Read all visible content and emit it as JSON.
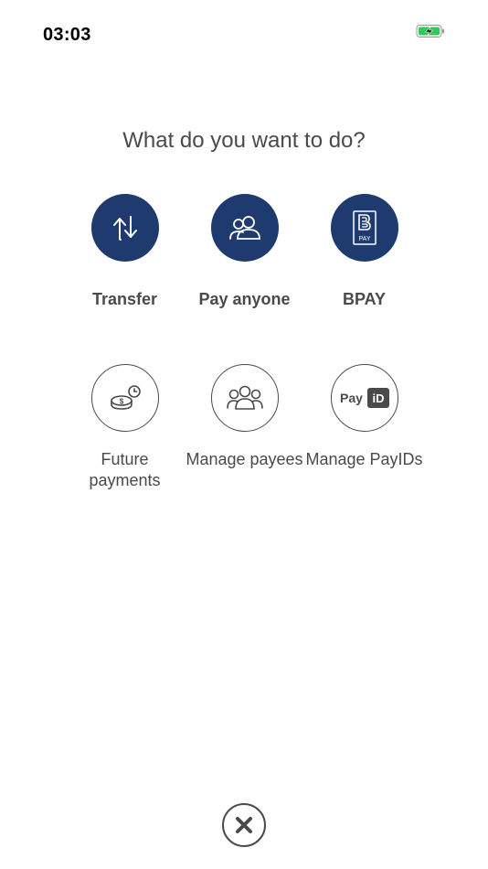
{
  "status_bar": {
    "time": "03:03",
    "battery_icon": "battery-charging-icon",
    "battery_color": "#34c759"
  },
  "prompt": "What do you want to do?",
  "actions_primary": [
    {
      "label": "Transfer",
      "icon": "transfer-arrows-icon"
    },
    {
      "label": "Pay anyone",
      "icon": "people-icon"
    },
    {
      "label": "BPAY",
      "icon": "bpay-logo-icon",
      "logo_text": "PAY"
    }
  ],
  "actions_secondary": [
    {
      "label": "Future payments",
      "icon": "coins-clock-icon"
    },
    {
      "label": "Manage payees",
      "icon": "group-icon"
    },
    {
      "label": "Manage PayIDs",
      "icon": "payid-logo-icon",
      "logo_text": "Pay",
      "logo_badge": "iD"
    }
  ],
  "close": {
    "icon": "close-icon"
  },
  "colors": {
    "brand": "#1e3a6e",
    "text": "#4a4a4a"
  }
}
